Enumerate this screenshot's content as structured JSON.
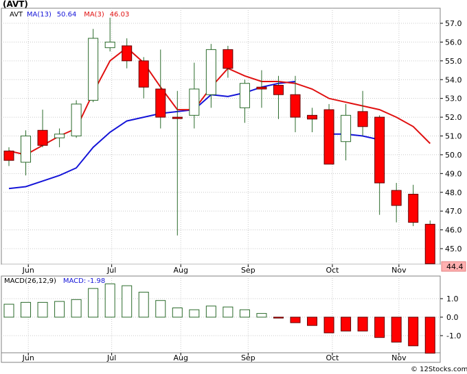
{
  "chart_data": [
    {
      "type": "candlestick",
      "ticker": "(AVT)",
      "legend": [
        {
          "label": "AVT",
          "value": "",
          "color": "#000000"
        },
        {
          "label": "MA(13)",
          "value": "50.64",
          "color": "#1414d8"
        },
        {
          "label": "MA(3)",
          "value": "46.03",
          "color": "#e01010"
        }
      ],
      "ylim": [
        44.0,
        57.7
      ],
      "y_ticks": [
        "57.0",
        "56.0",
        "55.0",
        "54.0",
        "53.0",
        "52.0",
        "51.0",
        "50.0",
        "49.0",
        "48.0",
        "47.0",
        "46.0",
        "45.0"
      ],
      "last_price_label": "44.4",
      "months": [
        "Jun",
        "Jul",
        "Aug",
        "Sep",
        "Oct",
        "Nov"
      ],
      "candles": [
        {
          "o": 49.7,
          "c": 50.2,
          "h": 50.4,
          "l": 49.4,
          "color": "red"
        },
        {
          "o": 49.6,
          "c": 51.0,
          "h": 51.3,
          "l": 48.9,
          "color": "white"
        },
        {
          "o": 51.3,
          "c": 50.5,
          "h": 52.4,
          "l": 50.4,
          "color": "red"
        },
        {
          "o": 50.9,
          "c": 51.1,
          "h": 51.4,
          "l": 50.4,
          "color": "white"
        },
        {
          "o": 51.0,
          "c": 52.7,
          "h": 52.9,
          "l": 50.9,
          "color": "white"
        },
        {
          "o": 52.9,
          "c": 56.2,
          "h": 56.7,
          "l": 52.8,
          "color": "white"
        },
        {
          "o": 55.7,
          "c": 56.0,
          "h": 57.3,
          "l": 55.5,
          "color": "white"
        },
        {
          "o": 55.8,
          "c": 55.0,
          "h": 56.2,
          "l": 54.6,
          "color": "red"
        },
        {
          "o": 55.0,
          "c": 53.6,
          "h": 55.2,
          "l": 53.0,
          "color": "red"
        },
        {
          "o": 53.5,
          "c": 52.0,
          "h": 55.6,
          "l": 51.4,
          "color": "red"
        },
        {
          "o": 52.0,
          "c": 52.0,
          "h": 53.4,
          "l": 45.7,
          "color": "red"
        },
        {
          "o": 52.1,
          "c": 53.5,
          "h": 54.9,
          "l": 51.4,
          "color": "white"
        },
        {
          "o": 53.2,
          "c": 55.6,
          "h": 55.9,
          "l": 52.5,
          "color": "white"
        },
        {
          "o": 55.6,
          "c": 54.6,
          "h": 55.8,
          "l": 54.1,
          "color": "red"
        },
        {
          "o": 52.5,
          "c": 53.8,
          "h": 54.0,
          "l": 51.7,
          "color": "white"
        },
        {
          "o": 53.6,
          "c": 53.5,
          "h": 54.5,
          "l": 52.5,
          "color": "red"
        },
        {
          "o": 53.7,
          "c": 53.2,
          "h": 54.2,
          "l": 51.9,
          "color": "red"
        },
        {
          "o": 53.2,
          "c": 52.0,
          "h": 54.2,
          "l": 51.2,
          "color": "red"
        },
        {
          "o": 52.1,
          "c": 51.9,
          "h": 52.5,
          "l": 51.2,
          "color": "red"
        },
        {
          "o": 52.4,
          "c": 49.5,
          "h": 52.7,
          "l": 49.5,
          "color": "red"
        },
        {
          "o": 50.7,
          "c": 52.1,
          "h": 52.7,
          "l": 49.7,
          "color": "white"
        },
        {
          "o": 52.3,
          "c": 51.5,
          "h": 53.4,
          "l": 51.0,
          "color": "red"
        },
        {
          "o": 52.0,
          "c": 48.5,
          "h": 52.1,
          "l": 46.8,
          "color": "red"
        },
        {
          "o": 48.1,
          "c": 47.3,
          "h": 48.5,
          "l": 46.4,
          "color": "red"
        },
        {
          "o": 47.9,
          "c": 46.4,
          "h": 48.4,
          "l": 46.2,
          "color": "red"
        },
        {
          "o": 46.3,
          "c": 44.2,
          "h": 46.5,
          "l": 44.2,
          "color": "red"
        }
      ],
      "ma13": [
        null,
        null,
        null,
        null,
        null,
        null,
        null,
        null,
        null,
        null,
        null,
        null,
        null,
        null,
        null,
        null,
        null,
        null,
        null,
        51.1,
        51.1,
        51.0,
        50.8,
        null,
        null,
        null
      ],
      "ma13_early": [
        48.2,
        48.3,
        48.6,
        48.9,
        49.3,
        50.4,
        51.2,
        51.8,
        52.0,
        52.2,
        52.4,
        52.5,
        53.2,
        53.1,
        53.3,
        53.6,
        53.8,
        53.9
      ],
      "ma3": [
        50.2,
        50.0,
        50.5,
        51.0,
        51.4,
        53.3,
        55.0,
        55.7,
        54.9,
        53.6,
        52.5,
        52.5,
        53.7,
        54.6,
        54.2,
        53.9,
        53.9,
        53.8,
        53.5,
        53.0,
        52.8,
        52.6,
        52.4,
        52.0,
        51.5,
        50.6
      ],
      "ma13_full": [
        48.2,
        48.3,
        48.6,
        48.9,
        49.3,
        50.4,
        51.2,
        51.8,
        52.0,
        52.2,
        52.3,
        52.4,
        53.2,
        53.1,
        53.3,
        53.6,
        53.8,
        53.9,
        null,
        51.1,
        51.1,
        51.0,
        50.8,
        null,
        null,
        null
      ],
      "ma3_series": [
        50.2,
        50.0,
        50.5,
        51.0,
        51.4,
        53.3,
        55.0,
        55.7,
        54.9,
        53.6,
        52.4,
        52.4,
        53.6,
        54.6,
        54.2,
        53.9,
        53.9,
        53.8,
        53.5,
        53.0,
        52.8,
        52.6,
        52.4,
        52.0,
        51.5,
        50.6
      ]
    },
    {
      "type": "bar",
      "name": "MACD",
      "legend": [
        {
          "label": "MACD(26,12,9)",
          "value": "",
          "color": "#000000"
        },
        {
          "label": "MACD:",
          "value": "-1.98",
          "color": "#1414d8"
        }
      ],
      "ylim": [
        -2.0,
        2.0
      ],
      "y_ticks": [
        "1.0",
        "0.0",
        "-1.0"
      ],
      "months": [
        "Jun",
        "Jul",
        "Aug",
        "Sep",
        "Oct",
        "Nov"
      ],
      "values": [
        0.7,
        0.8,
        0.8,
        0.85,
        0.95,
        1.55,
        1.8,
        1.7,
        1.35,
        0.9,
        0.5,
        0.4,
        0.6,
        0.55,
        0.4,
        0.2,
        -0.05,
        -0.3,
        -0.45,
        -0.85,
        -0.75,
        -0.75,
        -1.1,
        -1.35,
        -1.55,
        -1.95
      ]
    }
  ],
  "watermark": "© 12Stocks.com"
}
